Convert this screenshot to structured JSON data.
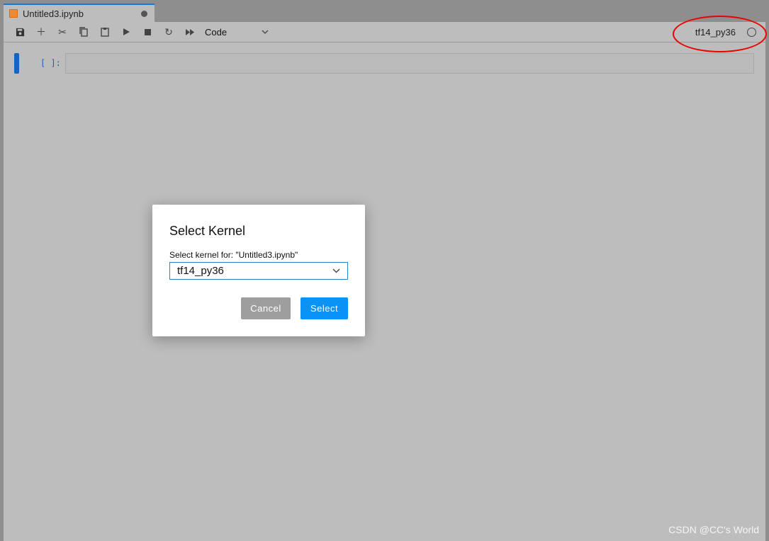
{
  "tab": {
    "title": "Untitled3.ipynb",
    "icon": "notebook-icon",
    "unsaved": true
  },
  "toolbar": {
    "icons": [
      "save-icon",
      "plus-icon",
      "cut-icon",
      "copy-icon",
      "paste-icon",
      "run-icon",
      "stop-icon",
      "restart-icon",
      "fast-forward-icon"
    ],
    "cell_type": "Code",
    "kernel_name": "tf14_py36",
    "kernel_status": "idle"
  },
  "cell": {
    "prompt": "[ ]:",
    "content": ""
  },
  "dialog": {
    "title": "Select Kernel",
    "label": "Select kernel for: \"Untitled3.ipynb\"",
    "selected": "tf14_py36",
    "cancel": "Cancel",
    "select": "Select"
  },
  "annotation": {
    "color": "#ee0000"
  },
  "colors": {
    "accent": "#1976d2",
    "select_button": "#0a93f5"
  },
  "watermark": "CSDN @CC's World"
}
